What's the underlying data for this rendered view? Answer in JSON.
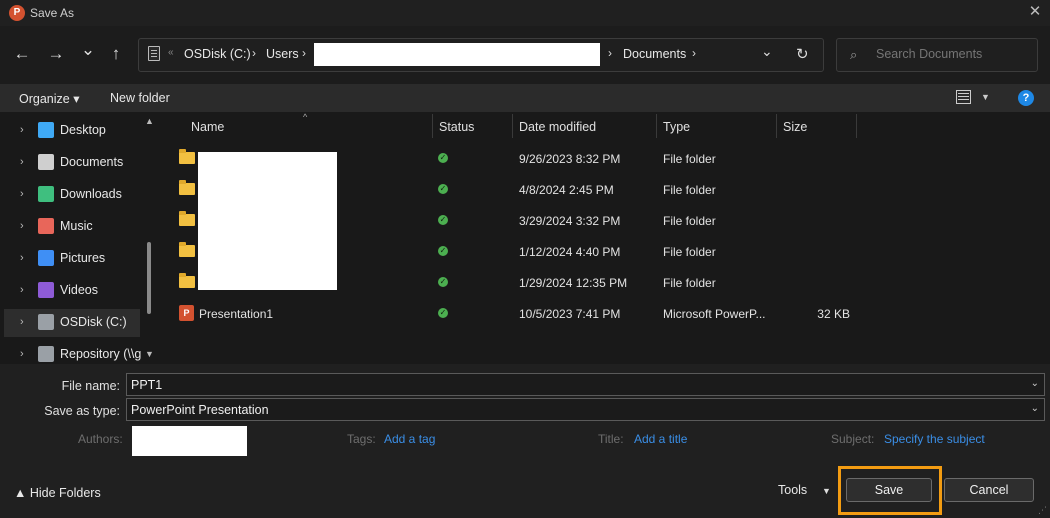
{
  "window": {
    "title": "Save As",
    "app_icon_letter": "P",
    "close_glyph": "✕"
  },
  "nav": {
    "back_glyph": "←",
    "forward_glyph": "→",
    "recent_glyph": "⌄",
    "up_glyph": "↑",
    "address_expand": "«",
    "breadcrumbs": [
      "OSDisk (C:)",
      "Users",
      "Documents"
    ],
    "sep_glyph": "›",
    "dropdown_glyph": "⌄",
    "refresh_glyph": "↻"
  },
  "search": {
    "placeholder": "Search Documents",
    "icon_glyph": "⌕"
  },
  "toolbar": {
    "organize_label": "Organize ▾",
    "new_folder_label": "New folder",
    "view_drop_glyph": "▼",
    "help_glyph": "?"
  },
  "sidebar": {
    "scroll_up_glyph": "▲",
    "scroll_down_glyph": "▼",
    "chevron_glyph": "›",
    "items": [
      {
        "label": "Desktop",
        "icon": "desktop-icon",
        "color": "#3fa9f5"
      },
      {
        "label": "Documents",
        "icon": "documents-icon",
        "color": "#cfcfcf"
      },
      {
        "label": "Downloads",
        "icon": "downloads-icon",
        "color": "#3fbf7f"
      },
      {
        "label": "Music",
        "icon": "music-icon",
        "color": "#e8665a"
      },
      {
        "label": "Pictures",
        "icon": "pictures-icon",
        "color": "#3f8ff5"
      },
      {
        "label": "Videos",
        "icon": "videos-icon",
        "color": "#8e5bd6"
      },
      {
        "label": "OSDisk (C:)",
        "icon": "drive-icon",
        "color": "#9aa0a6"
      },
      {
        "label": "Repository (\\\\g",
        "icon": "network-drive-icon",
        "color": "#9aa0a6"
      }
    ]
  },
  "columns": {
    "name": "Name",
    "status": "Status",
    "date": "Date modified",
    "type": "Type",
    "size": "Size",
    "sort_glyph": "^"
  },
  "files": [
    {
      "name": "",
      "status": "✓",
      "date": "9/26/2023 8:32 PM",
      "type": "File folder",
      "size": "",
      "kind": "folder"
    },
    {
      "name": "",
      "status": "✓",
      "date": "4/8/2024 2:45 PM",
      "type": "File folder",
      "size": "",
      "kind": "folder"
    },
    {
      "name": "",
      "status": "✓",
      "date": "3/29/2024 3:32 PM",
      "type": "File folder",
      "size": "",
      "kind": "folder"
    },
    {
      "name": "",
      "status": "✓",
      "date": "1/12/2024 4:40 PM",
      "type": "File folder",
      "size": "",
      "kind": "folder"
    },
    {
      "name": "",
      "status": "✓",
      "date": "1/29/2024 12:35 PM",
      "type": "File folder",
      "size": "",
      "kind": "folder"
    },
    {
      "name": "Presentation1",
      "status": "✓",
      "date": "10/5/2023 7:41 PM",
      "type": "Microsoft PowerP...",
      "size": "32 KB",
      "kind": "ppt"
    }
  ],
  "form": {
    "file_name_label": "File name:",
    "file_name_value": "PPT1",
    "save_type_label": "Save as type:",
    "save_type_value": "PowerPoint Presentation",
    "combo_glyph": "⌄",
    "authors_label": "Authors:",
    "tags_label": "Tags:",
    "tags_link": "Add a tag",
    "title_label": "Title:",
    "title_link": "Add a title",
    "subject_label": "Subject:",
    "subject_link": "Specify the subject"
  },
  "footer": {
    "hide_folders": "▲  Hide Folders",
    "tools": "Tools",
    "tools_drop": "▼",
    "save": "Save",
    "cancel": "Cancel",
    "grip": "⋰"
  },
  "colors": {
    "accent_highlight": "#f39c12",
    "link": "#3a8ee6",
    "status_ok": "#4caf50",
    "ppt": "#d35230"
  }
}
